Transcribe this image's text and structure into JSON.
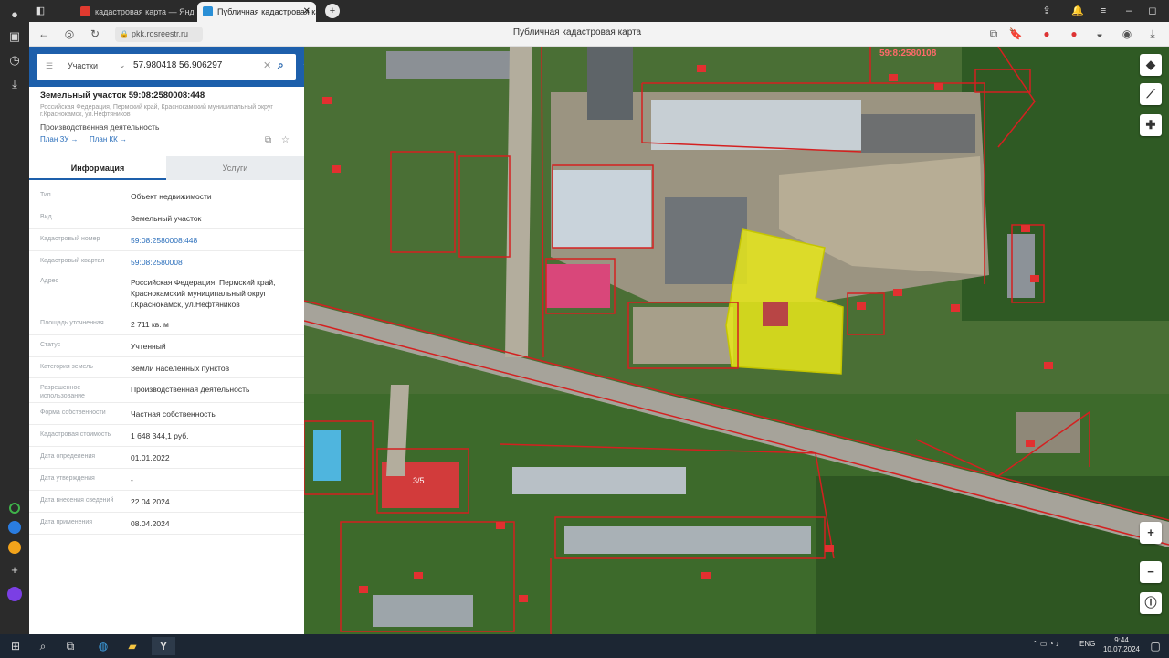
{
  "browser": {
    "tabs": [
      {
        "title": "кадастровая карта — Янд",
        "active": false,
        "icon_color": "#e03a2f"
      },
      {
        "title": "Публичная кадастровая карта",
        "active": true,
        "icon_color": "#2a8fd6"
      }
    ],
    "url": "pkk.rosreestr.ru",
    "page_title": "Публичная кадастровая карта",
    "new_tab_icon": "plus-icon"
  },
  "search": {
    "type_label": "Участки",
    "query": "57.980418 56.906297"
  },
  "object": {
    "title": "Земельный участок 59:08:2580008:448",
    "address_short": "Российская Федерация, Пермский край, Краснокамский муниципальный округ г.Краснокамск, ул.Нефтяников",
    "purpose": "Производственная деятельность",
    "link_plan_1": "План ЗУ →",
    "link_plan_2": "План КК →"
  },
  "info_tabs": [
    "Информация",
    "Услуги"
  ],
  "fields": [
    {
      "label": "Тип",
      "value": "Объект недвижимости",
      "link": false
    },
    {
      "label": "Вид",
      "value": "Земельный участок",
      "link": false
    },
    {
      "label": "Кадастровый номер",
      "value": "59:08:2580008:448",
      "link": true
    },
    {
      "label": "Кадастровый квартал",
      "value": "59:08:2580008",
      "link": true
    },
    {
      "label": "Адрес",
      "value": "Российская Федерация, Пермский край, Краснокамский муниципальный округ г.Краснокамск, ул.Нефтяников",
      "link": false
    },
    {
      "label": "Площадь уточненная",
      "value": "2 711 кв. м",
      "link": false
    },
    {
      "label": "Статус",
      "value": "Учтенный",
      "link": false
    },
    {
      "label": "Категория земель",
      "value": "Земли населённых пунктов",
      "link": false
    },
    {
      "label": "Разрешенное использование",
      "value": "Производственная деятельность",
      "link": false
    },
    {
      "label": "Форма собственности",
      "value": "Частная собственность",
      "link": false
    },
    {
      "label": "Кадастровая стоимость",
      "value": "1 648 344,1 руб.",
      "link": false
    },
    {
      "label": "Дата определения",
      "value": "01.01.2022",
      "link": false
    },
    {
      "label": "Дата утверждения",
      "value": "-",
      "link": false
    },
    {
      "label": "Дата внесения сведений",
      "value": "22.04.2024",
      "link": false
    },
    {
      "label": "Дата применения",
      "value": "08.04.2024",
      "link": false
    }
  ],
  "map": {
    "top_label": "59:8:2580108",
    "building_label": "3/5",
    "controls": {
      "layers": "layers-icon",
      "ruler": "ruler-icon",
      "locate": "crosshair-icon",
      "zoom_in": "+",
      "zoom_out": "−",
      "info": "info-icon"
    }
  },
  "taskbar": {
    "lang": "ENG",
    "time": "9:44",
    "date": "10.07.2024"
  }
}
